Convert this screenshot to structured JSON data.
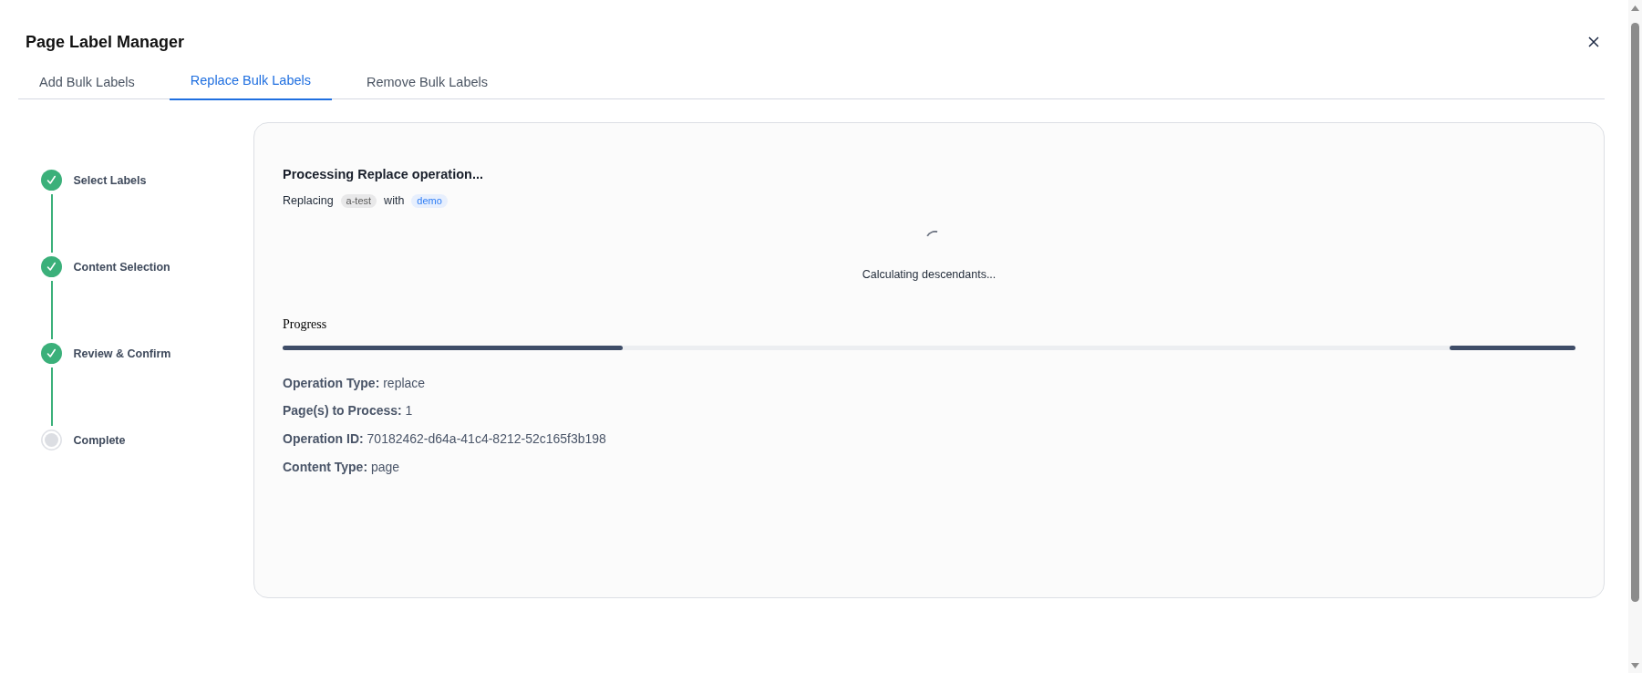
{
  "dialog": {
    "title": "Page Label Manager"
  },
  "tabs": [
    {
      "label": "Add Bulk Labels",
      "selected": false
    },
    {
      "label": "Replace Bulk Labels",
      "selected": true
    },
    {
      "label": "Remove Bulk Labels",
      "selected": false
    }
  ],
  "steps": [
    {
      "label": "Select Labels",
      "completed": true
    },
    {
      "label": "Content Selection",
      "completed": true
    },
    {
      "label": "Review & Confirm",
      "completed": true
    },
    {
      "label": "Complete",
      "completed": false
    }
  ],
  "operation": {
    "heading": "Processing Replace operation...",
    "summary": {
      "prefix": "Replacing",
      "old_label": "a-test",
      "joiner": "with",
      "new_label": "demo"
    },
    "status": "Calculating descendants...",
    "progress": {
      "label": "Progress",
      "kind": "indeterminate"
    },
    "details": [
      {
        "label": "Operation Type:",
        "value": "replace"
      },
      {
        "label": "Page(s) to Process:",
        "value": "1"
      },
      {
        "label": "Operation ID:",
        "value": "70182462-d64a-41c4-8212-52c165f3b198"
      },
      {
        "label": "Content Type:",
        "value": "page"
      }
    ]
  }
}
